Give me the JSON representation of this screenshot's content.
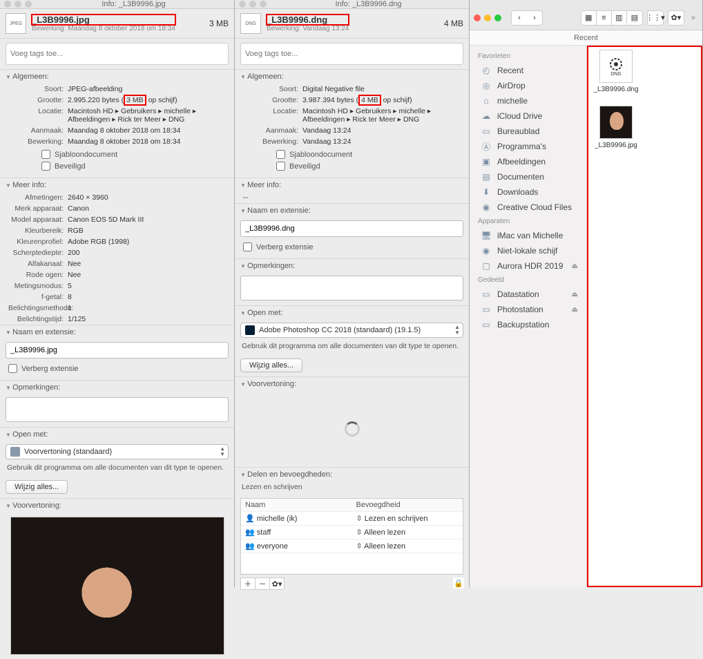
{
  "win1": {
    "title": "Info: _L3B9996.jpg",
    "filename": "_L3B9996.jpg",
    "modified": "Bewerking: Maandag 8 oktober 2018 om 18:34",
    "size": "3 MB",
    "tags_placeholder": "Voeg tags toe...",
    "sec_general": "Algemeen:",
    "kind_k": "Soort:",
    "kind_v": "JPEG-afbeelding",
    "fsize_k": "Grootte:",
    "fsize_v_pre": "2.995.220 bytes (",
    "fsize_v_hl": "3 MB",
    "fsize_v_post": " op schijf)",
    "loc_k": "Locatie:",
    "loc_v": "Macintosh HD ▸ Gebruikers ▸ michelle ▸ Afbeeldingen ▸ Rick ter Meer ▸ DNG",
    "created_k": "Aanmaak:",
    "created_v": "Maandag 8 oktober 2018 om 18:34",
    "mod_k": "Bewerking:",
    "mod_v": "Maandag 8 oktober 2018 om 18:34",
    "stationery": "Sjabloondocument",
    "locked": "Beveiligd",
    "sec_more": "Meer info:",
    "dims_k": "Afmetingen:",
    "dims_v": "2640 × 3960",
    "make_k": "Merk apparaat:",
    "make_v": "Canon",
    "model_k": "Model apparaat:",
    "model_v": "Canon EOS 5D Mark III",
    "cs_k": "Kleurbereik:",
    "cs_v": "RGB",
    "cp_k": "Kleurenprofiel:",
    "cp_v": "Adobe RGB (1998)",
    "depth_k": "Scherptediepte:",
    "depth_v": "200",
    "alpha_k": "Alfakanaal:",
    "alpha_v": "Nee",
    "redeye_k": "Rode ogen:",
    "redeye_v": "Nee",
    "metering_k": "Metingsmodus:",
    "metering_v": "5",
    "fnum_k": "f-getal:",
    "fnum_v": "8",
    "expprog_k": "Belichtingsmethode:",
    "expprog_v": "1",
    "exptime_k": "Belichtingstijd:",
    "exptime_v": "1/125",
    "sec_name": "Naam en extensie:",
    "name_val": "_L3B9996.jpg",
    "hide_ext": "Verberg extensie",
    "sec_comments": "Opmerkingen:",
    "sec_openwith": "Open met:",
    "openwith_val": "Voorvertoning (standaard)",
    "openwith_hint": "Gebruik dit programma om alle documenten van dit type te openen.",
    "change_all": "Wijzig alles...",
    "sec_preview": "Voorvertoning:"
  },
  "win2": {
    "title": "Info: _L3B9996.dng",
    "filename": "_L3B9996.dng",
    "modified": "Bewerking: Vandaag 13:24",
    "size": "4 MB",
    "tags_placeholder": "Voeg tags toe...",
    "sec_general": "Algemeen:",
    "kind_k": "Soort:",
    "kind_v": "Digital Negative file",
    "fsize_k": "Grootte:",
    "fsize_v_pre": "3.987.394 bytes (",
    "fsize_v_hl": "4 MB",
    "fsize_v_post": " op schijf)",
    "loc_k": "Locatie:",
    "loc_v": "Macintosh HD ▸ Gebruikers ▸ michelle ▸ Afbeeldingen ▸ Rick ter Meer ▸ DNG",
    "created_k": "Aanmaak:",
    "created_v": "Vandaag 13:24",
    "mod_k": "Bewerking:",
    "mod_v": "Vandaag 13:24",
    "stationery": "Sjabloondocument",
    "locked": "Beveiligd",
    "sec_more": "Meer info:",
    "more_val": "--",
    "sec_name": "Naam en extensie:",
    "name_val": "_L3B9996.dng",
    "hide_ext": "Verberg extensie",
    "sec_comments": "Opmerkingen:",
    "sec_openwith": "Open met:",
    "openwith_val": "Adobe Photoshop CC 2018 (standaard) (19.1.5)",
    "openwith_hint": "Gebruik dit programma om alle documenten van dit type te openen.",
    "change_all": "Wijzig alles...",
    "sec_preview": "Voorvertoning:",
    "sec_share": "Delen en bevoegdheden:",
    "share_summary": "Lezen en schrijven",
    "perm_name": "Naam",
    "perm_priv": "Bevoegdheid",
    "u1": "michelle (ik)",
    "p1": "Lezen en schrijven",
    "u2": "staff",
    "p2": "Alleen lezen",
    "u3": "everyone",
    "p3": "Alleen lezen"
  },
  "finder": {
    "path": "Recent",
    "sb": {
      "fav": "Favorieten",
      "recent": "Recent",
      "airdrop": "AirDrop",
      "michelle": "michelle",
      "icloud": "iCloud Drive",
      "desktop": "Bureaublad",
      "apps": "Programma's",
      "pictures": "Afbeeldingen",
      "docs": "Documenten",
      "downloads": "Downloads",
      "ccfiles": "Creative Cloud Files",
      "devices": "Apparaten",
      "imac": "iMac van Michelle",
      "remote": "Niet-lokale schijf",
      "aurora": "Aurora HDR 2019",
      "shared": "Gedeeld",
      "data": "Datastation",
      "photo": "Photostation",
      "backup": "Backupstation"
    },
    "file1": "_L3B9996.dng",
    "file2": "_L3B9996.jpg"
  }
}
